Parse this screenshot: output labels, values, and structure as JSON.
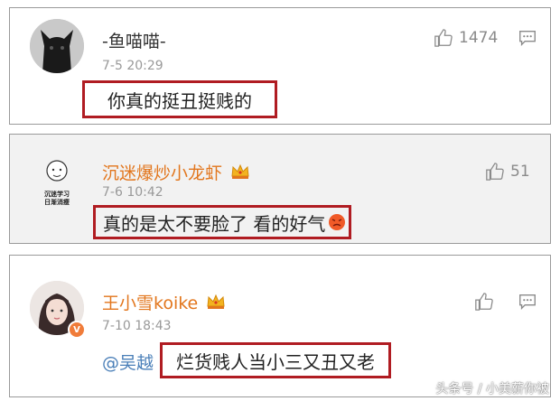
{
  "comments": [
    {
      "username": "-鱼喵喵-",
      "time": "7-5 20:29",
      "text": "你真的挺丑挺贱的",
      "likes": "1474"
    },
    {
      "username": "沉迷爆炒小龙虾",
      "avatar_text": "沉迷学习\n日渐消瘦",
      "time": "7-6 10:42",
      "text": "真的是太不要脸了 看的好气",
      "likes": "51"
    },
    {
      "username": "王小雪koike",
      "time": "7-10 18:43",
      "mention": "@吴越",
      "text": "烂货贱人当小三又丑又老",
      "likes": ""
    }
  ],
  "watermark": "头条号 / 小美薪你被",
  "colors": {
    "highlight_border": "#b01c22",
    "vip_name": "#e2761d",
    "mention": "#4a7fb8"
  }
}
